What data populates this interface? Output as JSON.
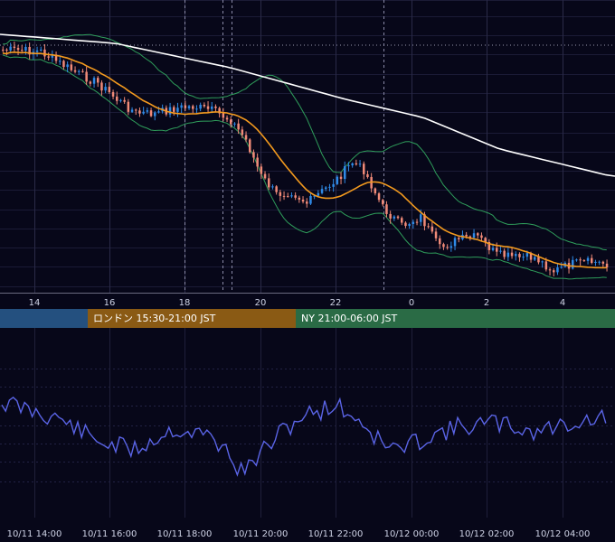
{
  "chart_data": [
    {
      "type": "candlestick",
      "title": "",
      "x_tick_labels": [
        "14",
        "16",
        "18",
        "20",
        "22",
        "0",
        "2",
        "4"
      ],
      "overlays": [
        {
          "name": "",
          "color": "#ffffff",
          "kind": "line"
        },
        {
          "name": "",
          "color": "#f39a1e",
          "kind": "line"
        },
        {
          "name": "",
          "color": "#2f9e5b",
          "kind": "band"
        }
      ],
      "candle_colors": {
        "up": "#2f8ae6",
        "down": "#f08a78"
      },
      "horizontal_reference_line": "dotted",
      "grid": true
    },
    {
      "type": "line",
      "title": "",
      "series": [
        {
          "name": "",
          "color": "#5a64e6"
        }
      ],
      "x_tick_labels": [
        "10/11 14:00",
        "10/11 16:00",
        "10/11 18:00",
        "10/11 20:00",
        "10/11 22:00",
        "10/12 00:00",
        "10/12 02:00",
        "10/12 04:00"
      ],
      "grid": true
    }
  ],
  "sessions": [
    {
      "label": "",
      "color": "#24507f"
    },
    {
      "label": "ロンドン 15:30-21:00 JST",
      "color": "#8a5a14"
    },
    {
      "label": "NY 21:00-06:00 JST",
      "color": "#2a6b45"
    }
  ]
}
